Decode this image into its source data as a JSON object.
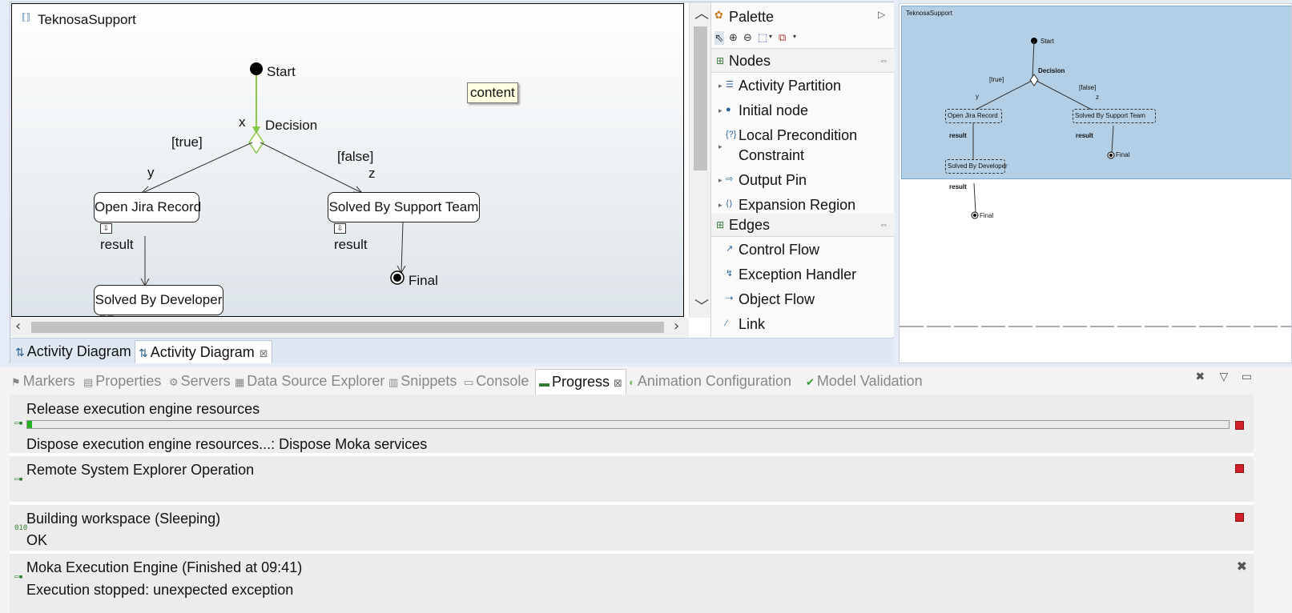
{
  "diagram": {
    "title": "TeknosaSupport",
    "start_label": "Start",
    "decision_label": "Decision",
    "guard_x": "x",
    "guard_true": "[true]",
    "guard_false": "[false]",
    "edge_y": "y",
    "edge_z": "z",
    "node_open_jira": "Open Jira Record",
    "node_support_team": "Solved By Support Team",
    "node_developer": "Solved By Developer",
    "pin_result_1": "result",
    "pin_result_2": "result",
    "final_label": "Final",
    "tooltip": "content"
  },
  "editor_tabs": [
    {
      "label": "Activity Diagram"
    },
    {
      "label": "Activity Diagram"
    }
  ],
  "palette": {
    "title": "Palette",
    "nodes_header": "Nodes",
    "nodes": [
      {
        "label": "Activity Partition",
        "icon": "partition-icon"
      },
      {
        "label": "Initial node",
        "icon": "initial-node-icon"
      },
      {
        "label": "Local Precondition Constraint",
        "icon": "constraint-icon"
      },
      {
        "label": "Output Pin",
        "icon": "output-pin-icon"
      },
      {
        "label": "Expansion Region",
        "icon": "expansion-region-icon"
      }
    ],
    "edges_header": "Edges",
    "edges": [
      {
        "label": "Control Flow",
        "icon": "control-flow-icon"
      },
      {
        "label": "Exception Handler",
        "icon": "exception-handler-icon"
      },
      {
        "label": "Object Flow",
        "icon": "object-flow-icon"
      },
      {
        "label": "Link",
        "icon": "link-icon"
      }
    ]
  },
  "outline": {
    "title": "TeknosaSupport",
    "start": "Start",
    "decision": "Decision",
    "guard_true": "[true]",
    "guard_false": "[false]",
    "edge_y": "y",
    "edge_z": "z",
    "open_jira": "Open Jira Record",
    "support_team": "Solved By Support Team",
    "developer": "Solved By Developer",
    "result1": "result",
    "result2": "result",
    "result3": "result",
    "final1": "Final",
    "final2": "Final"
  },
  "view_tabs": [
    {
      "label": "Markers"
    },
    {
      "label": "Properties"
    },
    {
      "label": "Servers"
    },
    {
      "label": "Data Source Explorer"
    },
    {
      "label": "Snippets"
    },
    {
      "label": "Console"
    },
    {
      "label": "Progress"
    },
    {
      "label": "Animation Configuration"
    },
    {
      "label": "Model Validation"
    }
  ],
  "progress": {
    "entries": [
      {
        "title": "Release execution engine resources",
        "detail": "Dispose execution engine resources...: Dispose Moka services",
        "progress": 0.004
      },
      {
        "title": "Remote System Explorer Operation",
        "detail": ""
      },
      {
        "title": "Building workspace (Sleeping)",
        "detail": "OK"
      },
      {
        "title": "Moka Execution Engine (Finished at 09:41)",
        "detail": "Execution stopped: unexpected exception"
      }
    ]
  },
  "colors": {
    "accent_green": "#8ac64a",
    "progress_green": "#25b025",
    "stop_red": "#d0202a",
    "outline_selection": "#b3cfe6"
  }
}
